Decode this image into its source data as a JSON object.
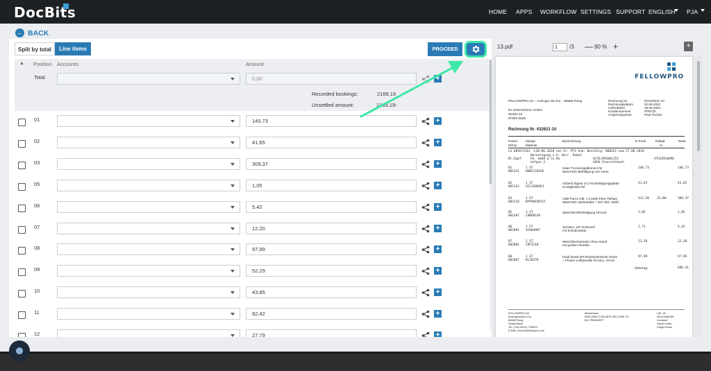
{
  "app": {
    "logo_main": "Doc",
    "logo_accent": "Bits",
    "nav": [
      "HOME",
      "APPS",
      "WORKFLOW",
      "SETTINGS",
      "SUPPORT"
    ],
    "language": "ENGLISH",
    "user": "PJA"
  },
  "back_label": "BACK",
  "tabs": {
    "split": "Split by total",
    "line_items": "Line items"
  },
  "proceed_label": "PROCEED",
  "columns": {
    "position": "Position",
    "accounts": "Accounts",
    "amount": "Amount"
  },
  "total": {
    "label": "Total",
    "amount": "0,00"
  },
  "summary": {
    "recorded_label": "Recorded bookings:",
    "recorded_value": "2169,19",
    "unsettled_label": "Unsettled amount:",
    "unsettled_value": "2169,19-"
  },
  "rows": [
    {
      "pos": "01",
      "amount": "140,73"
    },
    {
      "pos": "02",
      "amount": "41,65"
    },
    {
      "pos": "03",
      "amount": "309,37"
    },
    {
      "pos": "05",
      "amount": "1,05"
    },
    {
      "pos": "06",
      "amount": "5,42"
    },
    {
      "pos": "07",
      "amount": "12,20"
    },
    {
      "pos": "08",
      "amount": "97,99"
    },
    {
      "pos": "09",
      "amount": "52,29"
    },
    {
      "pos": "10",
      "amount": "43,85"
    },
    {
      "pos": "11",
      "amount": "82,42"
    },
    {
      "pos": "12",
      "amount": "27,79"
    }
  ],
  "pdf": {
    "file": "13.pdf",
    "page": "1",
    "pages": "/3",
    "zoom": "90 %",
    "zoom_out": "—",
    "zoom_in": "+",
    "download": "+",
    "doc": {
      "brand": "FELLOWPRO",
      "sender": "FELLOWPRO AG – Anzinger Str.21a – 85586 Poing",
      "recipient": [
        "Ihr Unternehmen GmbH",
        "Straße 45",
        "67809 Stadt"
      ],
      "meta_labels": [
        "Rechnung Nr.",
        "Rechnungsdatum",
        "Lieferdatum",
        "Kundennummer",
        "Ansprechpartner"
      ],
      "meta_values": [
        "RG432621-10",
        "20.06.2023",
        "28.05.2023",
        "PP8732",
        "Paul Fischer"
      ],
      "title": "Rechnung Nr. 432621-10",
      "headers": [
        "Pos/nr",
        "Menge",
        "Bezeichnung",
        "E-Preis",
        "Rabatt",
        "Netto"
      ],
      "subheaders": [
        "WGrp",
        "Material",
        "%"
      ],
      "ls_line": "LS 605671261 -L28.06.2018 ven Hl. PTS Anb. Bestätig: B80321 vom 27.06.2018",
      "ls_sub": [
        "Warenlegung z.H. Herr. Robot",
        "Ek. GmbH & Co KG",
        "Gefpen 2"
      ],
      "ls_sub2": [
        "0176/891061251",
        "4056 Dienstelbach"
      ],
      "ls_ref": "ATU16918496",
      "ls_left": "Bl.Empf.",
      "items": [
        {
          "pos": "01",
          "mat": "001331",
          "qty": "1 ST",
          "code": "HUWIC102OG",
          "desc": "Haier Trockenspaltement für",
          "desc2": "Wand-WC-Befülligung von vorne",
          "price": "140,73",
          "disc": "",
          "net": "140,73"
        },
        {
          "pos": "02",
          "mat": "001332",
          "qty": "1 ST",
          "code": "GE115882KJ",
          "desc": "Geberit Sigma 10 2-M Betätigungsplatte",
          "desc2": "w.mitglasste.mit",
          "price": "41,65",
          "disc": "",
          "net": "41,65"
        },
        {
          "pos": "03",
          "mat": "002234",
          "qty": "1 ST",
          "code": "BYPAKEVKICF",
          "desc": "V&B Pacco Kdt. 1 Combi-Pack Tiefspü",
          "desc2": "Wand-WC spülrandlos + WC-Sitz, Weiß",
          "price": "412,50",
          "disc": "25,00-",
          "net": "309,37"
        },
        {
          "pos": "05",
          "mat": "001307",
          "qty": "1 ST",
          "code": "CONVB140",
          "desc": "Waschtischbefestigung 10x140",
          "desc2": "",
          "price": "1,05",
          "disc": "",
          "net": "1,05"
        },
        {
          "pos": "06",
          "mat": "002091",
          "qty": "2 ST",
          "code": "SCH04907",
          "desc": "SCHELL 1/2\" Eckventil",
          "desc2": "mit Schubrosette",
          "price": "2,71",
          "disc": "",
          "net": "5,42"
        },
        {
          "pos": "07",
          "mat": "002001",
          "qty": "1 ST",
          "code": "CDF3210",
          "desc": "Waschtischarmatur ohne Handt",
          "desc2": "mit großen Rosette",
          "price": "12,20",
          "disc": "",
          "net": "12,20"
        },
        {
          "pos": "08",
          "mat": "002067",
          "qty": "1 ST",
          "code": "KL28259",
          "desc": "Kludi Zenta WT-Einhandmischer DN15",
          "desc2": "+ Pionier Luftsprudler M 24x1, chrom",
          "price": "97,99",
          "disc": "",
          "net": "97,99"
        }
      ],
      "carry_label": "Übertrag:",
      "carry_value": "606,41",
      "footer_left": [
        "FELLOWPRO AG",
        "Anzingerstraße 21a",
        "85586 Poing",
        "Deutschland",
        "Tel. (+49) 08121 79390-0",
        "E-Mail: service@fellowpro.com"
      ],
      "footer_mid": [
        "Musterbank",
        "IBAN DE00 1234 5678 9012 3456 78",
        "BIC PBNKDEFF"
      ],
      "footer_right": [
        "USt.-ID:",
        "DE123456789",
        "Vorstand:",
        "Daniel Leiter",
        "Holger Armor"
      ]
    }
  }
}
